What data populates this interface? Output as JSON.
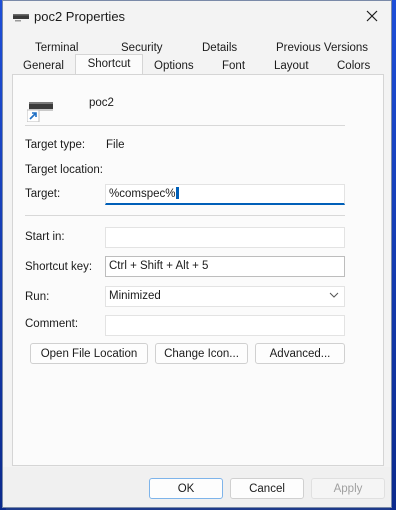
{
  "window": {
    "title": "poc2 Properties"
  },
  "tabs_row1": [
    "Terminal",
    "Security",
    "Details",
    "Previous Versions"
  ],
  "tabs_row2": [
    "General",
    "Shortcut",
    "Options",
    "Font",
    "Layout",
    "Colors"
  ],
  "active_tab": "Shortcut",
  "file": {
    "name": "poc2"
  },
  "fields": {
    "target_type_label": "Target type:",
    "target_type_value": "File",
    "target_location_label": "Target location:",
    "target_label": "Target:",
    "target_value": "%comspec%",
    "start_in_label": "Start in:",
    "start_in_value": "",
    "shortcut_key_label": "Shortcut key:",
    "shortcut_key_value": "Ctrl + Shift + Alt + 5",
    "run_label": "Run:",
    "run_value": "Minimized",
    "comment_label": "Comment:",
    "comment_value": ""
  },
  "buttons": {
    "open_file_location": "Open File Location",
    "change_icon": "Change Icon...",
    "advanced": "Advanced...",
    "ok": "OK",
    "cancel": "Cancel",
    "apply": "Apply"
  },
  "icons": {
    "title_icon": "console-shortcut-icon",
    "close_icon": "close-icon",
    "file_icon": "console-shortcut-icon",
    "select_chevron": "chevron-down-icon"
  },
  "colors": {
    "accent": "#005fb8",
    "window_bg": "#f3f3f3",
    "panel_bg": "#fbfbfb"
  }
}
